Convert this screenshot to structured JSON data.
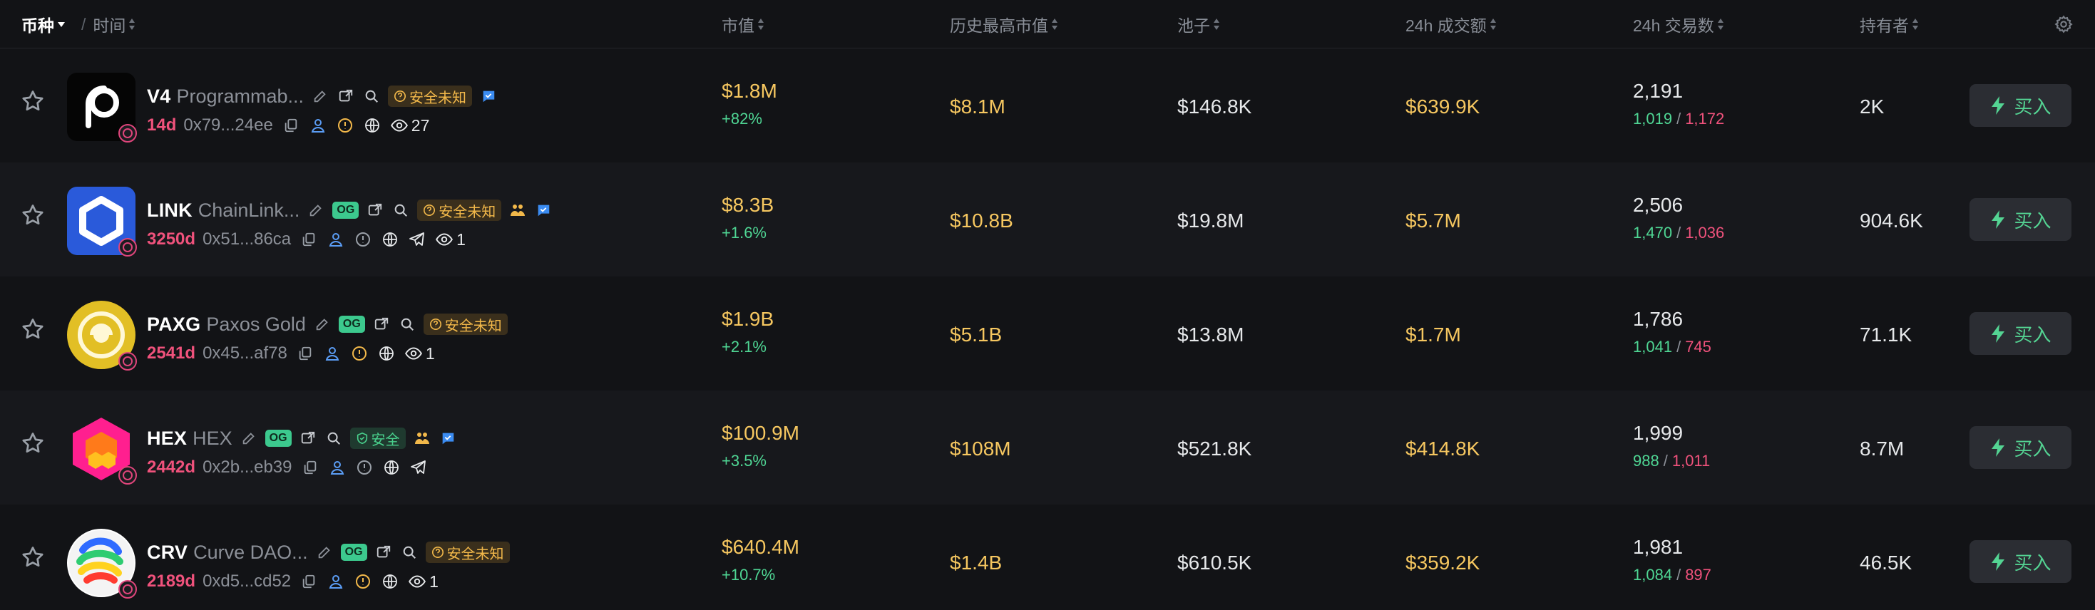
{
  "header": {
    "coin": "币种",
    "time": "时间",
    "mcap": "市值",
    "ath": "历史最高市值",
    "pool": "池子",
    "vol": "24h 成交额",
    "txs": "24h 交易数",
    "holders": "持有者"
  },
  "rows": [
    {
      "symbol": "V4",
      "name": "Programmab...",
      "og": false,
      "safety": "安全未知",
      "safety_level": "unknown",
      "age": "14d",
      "addr": "0x79...24ee",
      "views": "27",
      "mcap": "$1.8M",
      "mcap_change": "+82%",
      "ath": "$8.1M",
      "pool": "$146.8K",
      "vol": "$639.9K",
      "txs": "2,191",
      "buys": "1,019",
      "sells": "1,172",
      "holders": "2K",
      "buy_label": "买入"
    },
    {
      "symbol": "LINK",
      "name": "ChainLink...",
      "og": true,
      "og_label": "OG",
      "safety": "安全未知",
      "safety_level": "unknown",
      "age": "3250d",
      "addr": "0x51...86ca",
      "views": "1",
      "mcap": "$8.3B",
      "mcap_change": "+1.6%",
      "ath": "$10.8B",
      "pool": "$19.8M",
      "vol": "$5.7M",
      "txs": "2,506",
      "buys": "1,470",
      "sells": "1,036",
      "holders": "904.6K",
      "buy_label": "买入"
    },
    {
      "symbol": "PAXG",
      "name": "Paxos Gold",
      "og": true,
      "og_label": "OG",
      "safety": "安全未知",
      "safety_level": "unknown",
      "age": "2541d",
      "addr": "0x45...af78",
      "views": "1",
      "mcap": "$1.9B",
      "mcap_change": "+2.1%",
      "ath": "$5.1B",
      "pool": "$13.8M",
      "vol": "$1.7M",
      "txs": "1,786",
      "buys": "1,041",
      "sells": "745",
      "holders": "71.1K",
      "buy_label": "买入"
    },
    {
      "symbol": "HEX",
      "name": "HEX",
      "og": true,
      "og_label": "OG",
      "safety": "安全",
      "safety_level": "safe",
      "age": "2442d",
      "addr": "0x2b...eb39",
      "mcap": "$100.9M",
      "mcap_change": "+3.5%",
      "ath": "$108M",
      "pool": "$521.8K",
      "vol": "$414.8K",
      "txs": "1,999",
      "buys": "988",
      "sells": "1,011",
      "holders": "8.7M",
      "buy_label": "买入"
    },
    {
      "symbol": "CRV",
      "name": "Curve DAO...",
      "og": true,
      "og_label": "OG",
      "safety": "安全未知",
      "safety_level": "unknown",
      "age": "2189d",
      "addr": "0xd5...cd52",
      "views": "1",
      "mcap": "$640.4M",
      "mcap_change": "+10.7%",
      "ath": "$1.4B",
      "pool": "$610.5K",
      "vol": "$359.2K",
      "txs": "1,981",
      "buys": "1,084",
      "sells": "897",
      "holders": "46.5K",
      "buy_label": "买入"
    }
  ],
  "colors": {
    "background": "#121316",
    "row_alt": "#17181c",
    "gold": "#f6c760",
    "green": "#4fd694",
    "red": "#f0527c"
  }
}
